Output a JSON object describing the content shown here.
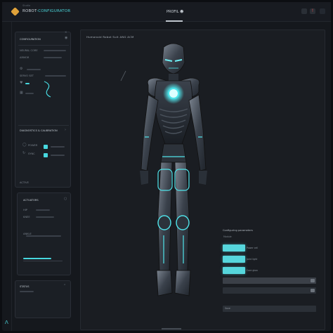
{
  "header": {
    "tagline": "Studio",
    "app_title": "ROBOT",
    "app_title_accent": "-CONFIGURATOR",
    "center_title": "PROFIL",
    "center_icon": "user-icon",
    "notification_glyph": "!"
  },
  "left_panel": {
    "section1_title": "CONFIGURATION",
    "row1_label": "NEURAL CORE",
    "row2_label": "ARMOR",
    "row3_label": "SERVO SET",
    "section2_title": "DIAGNOSTICS & CALIBRATION",
    "row4_label": "POWER",
    "row5_label": "SYNC",
    "footer_label": "ACTIVE"
  },
  "card2": {
    "title": "ACTUATORS",
    "row1_label": "HIP",
    "row2_label": "KNEE",
    "row3_label": "ANKLE"
  },
  "card3": {
    "title": "STATUS"
  },
  "viewport": {
    "title": "Humanoid Robot Suit   ANG ACM",
    "spec_title": "Configuring parameters",
    "spec_subtitle": "Module"
  },
  "swatches": [
    {
      "label": "Power cell",
      "color": "#56d6dc"
    },
    {
      "label": "Joint light",
      "color": "#56d6dc"
    },
    {
      "label": "Core glow",
      "color": "#56d6dc"
    }
  ],
  "fields": [
    {
      "placeholder": ""
    },
    {
      "placeholder": ""
    },
    {
      "placeholder": "Save"
    }
  ],
  "colors": {
    "accent": "#47d8df",
    "logo": "#e0a23a",
    "background": "#15181d"
  }
}
